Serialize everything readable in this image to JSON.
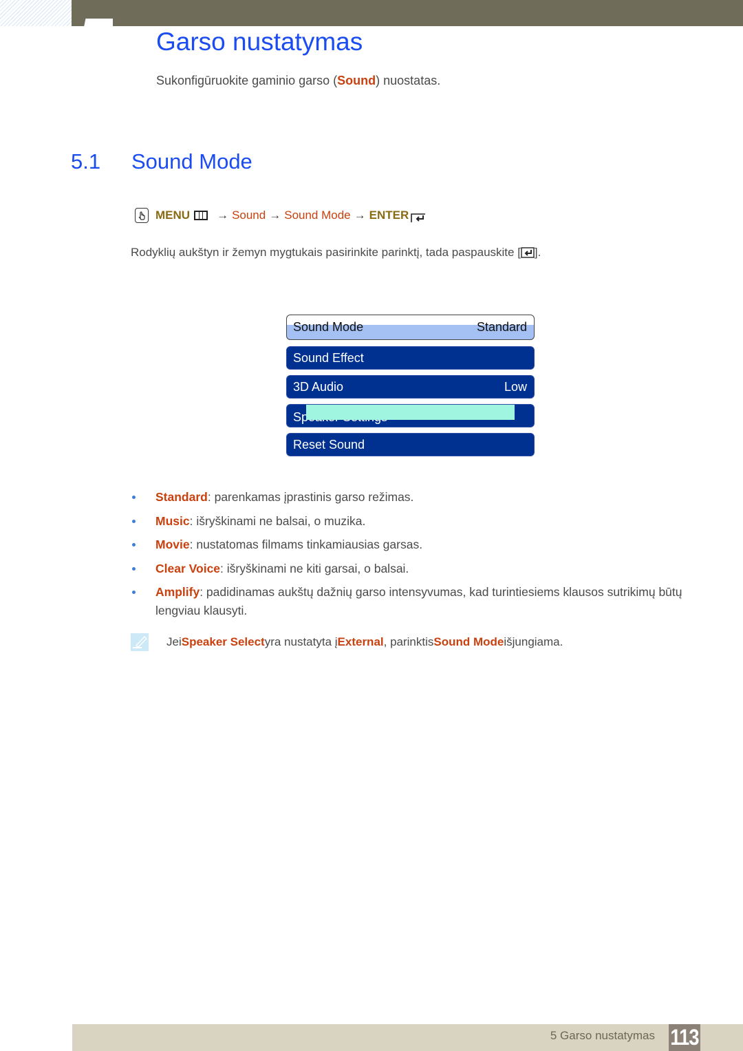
{
  "header": {
    "chapter_title": "Garso nustatymas",
    "intro": {
      "before": "Sukonfigūruokite gaminio garso (",
      "highlight": "Sound",
      "after": ") nuostatas."
    }
  },
  "section": {
    "number": "5.1",
    "title": "Sound Mode"
  },
  "menu_path": {
    "menu_label": "MENU",
    "arrow": "→",
    "steps": [
      "Sound",
      "Sound Mode"
    ],
    "enter_label": "ENTER"
  },
  "instruction": {
    "text": "Rodyklių aukštyn ir žemyn mygtukais pasirinkite parinktį, tada paspauskite [",
    "after": "]."
  },
  "osd_menu": {
    "items": [
      {
        "label": "Sound Mode",
        "value": "Standard",
        "selected": true
      },
      {
        "label": "Sound Effect",
        "value": ""
      },
      {
        "label": "3D Audio",
        "value": "Low"
      },
      {
        "label": "Speaker Settings",
        "value": ""
      },
      {
        "label": "Reset Sound",
        "value": ""
      }
    ]
  },
  "bullets": [
    {
      "term": "Standard",
      "desc": ": parenkamas įprastinis garso režimas."
    },
    {
      "term": "Music",
      "desc": ": išryškinami ne balsai, o muzika."
    },
    {
      "term": "Movie",
      "desc": ": nustatomas filmams tinkamiausias garsas."
    },
    {
      "term": "Clear Voice",
      "desc": ": išryškinami ne kiti garsai, o balsai."
    },
    {
      "term": "Amplify",
      "desc": ": padidinamas aukštų dažnių garso intensyvumas, kad turintiesiems klausos sutrikimų būtų lengviau klausyti."
    }
  ],
  "note": {
    "p1": "Jei ",
    "h1": "Speaker Select",
    "p2": " yra nustatyta į ",
    "h2": "External",
    "p3": ", parinktis ",
    "h3": "Sound Mode",
    "p4": " išjungiama."
  },
  "footer": {
    "chapter_label": "5 Garso nustatymas",
    "page_number": "113"
  },
  "colors": {
    "title_blue": "#1a4cf0",
    "highlight_orange": "#c8410e",
    "menu_olive": "#8a6a12",
    "osd_blue": "#003090",
    "osd_selected": "#a5c1f4",
    "topbar": "#6f6c5a",
    "footer_bar": "#d9d4c1",
    "page_badge": "#8c8177"
  }
}
